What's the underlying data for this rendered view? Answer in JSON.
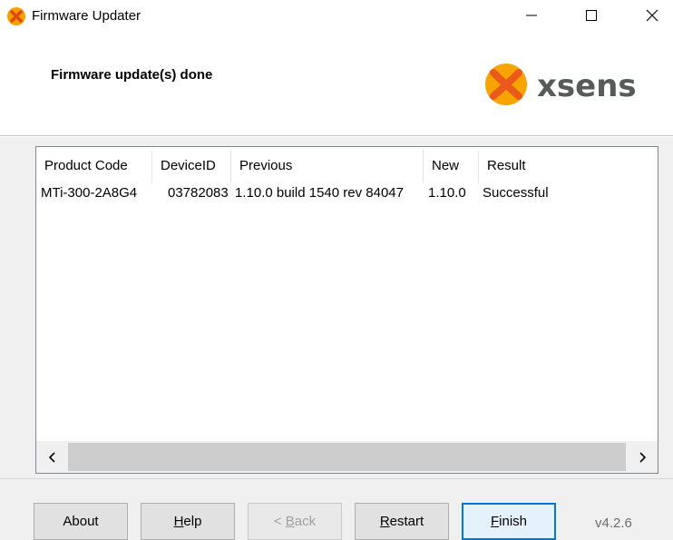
{
  "window": {
    "title": "Firmware Updater",
    "icon": "xsens-logo-icon"
  },
  "header": {
    "title": "Firmware update(s) done",
    "logo_text": "xsens",
    "brand_color": "#f5a000",
    "logo_x_color": "#e05a1a"
  },
  "table": {
    "columns": [
      "Product Code",
      "DeviceID",
      "Previous",
      "New",
      "Result"
    ],
    "rows": [
      [
        "MTi-300-2A8G4",
        "03782083",
        "1.10.0 build 1540 rev 84047",
        "1.10.0",
        "Successful"
      ]
    ]
  },
  "buttons": {
    "about": "About",
    "help_prefix": "",
    "help_u": "H",
    "help_rest": "elp",
    "back_prefix": "< ",
    "back_u": "B",
    "back_rest": "ack",
    "restart_u": "R",
    "restart_rest": "estart",
    "finish_u": "F",
    "finish_rest": "inish"
  },
  "version": "v4.2.6"
}
